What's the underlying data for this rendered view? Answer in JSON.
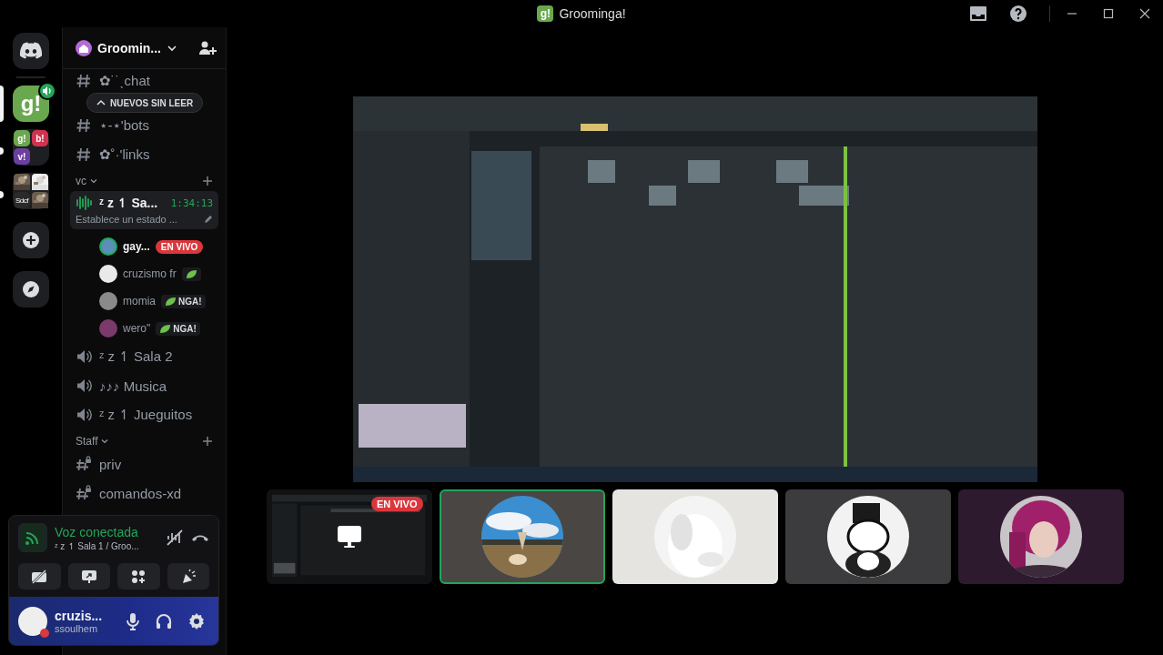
{
  "window": {
    "logo": "g!",
    "title": "Groominga!"
  },
  "server_rail": [
    {
      "kind": "server",
      "tiles": [
        {
          "kind": "label",
          "text": "g!",
          "color": "#6aa84f"
        }
      ],
      "selected": true,
      "in_voice": true
    },
    {
      "kind": "folder",
      "tiles": [
        {
          "kind": "label",
          "text": "g!",
          "color": "#6aa84f"
        },
        {
          "kind": "label",
          "text": "b!",
          "color": "#d0324f"
        },
        {
          "kind": "label",
          "text": "v!",
          "color": "#6b3fa0"
        }
      ],
      "selected": false,
      "unread": true
    },
    {
      "kind": "folder",
      "tiles": [
        {
          "kind": "picture"
        },
        {
          "kind": "picture"
        },
        {
          "kind": "label",
          "text": "Sdcf",
          "color": "#2a2a2a"
        },
        {
          "kind": "picture"
        }
      ],
      "selected": false,
      "unread": true
    }
  ],
  "sidebar": {
    "server_name": "Groomin...",
    "unread_pill": "NUEVOS SIN LEER",
    "top_channels": [
      {
        "kind": "text",
        "name": "✿˙˙ˎchat"
      },
      {
        "kind": "text",
        "name": "⋆-⋆'bots"
      },
      {
        "kind": "text",
        "name": "✿˚·'links"
      }
    ],
    "categories": [
      {
        "name": "vc",
        "channels": [
          {
            "kind": "voice",
            "name": "ᶻ z ↿ Sa...",
            "selected": true,
            "time": "1:34:13",
            "status": "Establece un estado ...",
            "members": [
              {
                "name": "gay...",
                "speaking": true,
                "badge": {
                  "kind": "live",
                  "text": "EN VIVO"
                }
              },
              {
                "name": "cruzismo fr",
                "speaking": false,
                "badge": {
                  "kind": "tag"
                }
              },
              {
                "name": "momia",
                "speaking": false,
                "badge": {
                  "kind": "tag",
                  "text": "NGA!"
                }
              },
              {
                "name": "wero\"",
                "speaking": false,
                "badge": {
                  "kind": "tag",
                  "text": "NGA!"
                }
              }
            ]
          },
          {
            "kind": "voice",
            "name": "ᶻ z ↿ Sala 2",
            "selected": false
          },
          {
            "kind": "voice",
            "name": "♪♪♪ Musica",
            "selected": false
          },
          {
            "kind": "voice",
            "name": "ᶻ z ↿ Jueguitos",
            "selected": false
          }
        ]
      },
      {
        "name": "Staff",
        "channels": [
          {
            "kind": "locked",
            "name": "priv",
            "selected": false
          },
          {
            "kind": "locked",
            "name": "comandos-xd",
            "selected": false
          }
        ]
      }
    ]
  },
  "voice_panel": {
    "status": "Voz conectada",
    "location": "ᶻ z ↿ Sala 1 / Groo..."
  },
  "user": {
    "name": "cruzis...",
    "handle": "ssoulhem",
    "do_not_disturb": true
  },
  "tiles": [
    {
      "kind": "screen",
      "speaking": false,
      "badge": "EN VIVO",
      "color": "#111214"
    },
    {
      "kind": "avatar",
      "speaking": true,
      "color": "#4a4643"
    },
    {
      "kind": "avatar",
      "speaking": false,
      "color": "#e6e4e1"
    },
    {
      "kind": "avatar",
      "speaking": false,
      "color": "#3c3c3e"
    },
    {
      "kind": "avatar",
      "speaking": false,
      "color": "#2e1a2e"
    }
  ]
}
